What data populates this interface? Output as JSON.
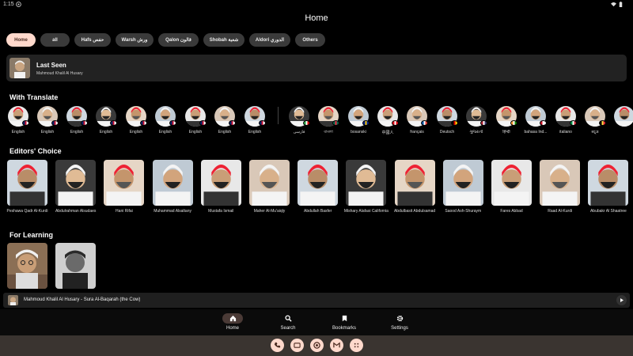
{
  "status": {
    "time": "1:15"
  },
  "appbar": {
    "title": "Home"
  },
  "chips": [
    {
      "label": "Home",
      "active": true
    },
    {
      "label": "all"
    },
    {
      "label": "Hafs حفص"
    },
    {
      "label": "Warsh ورش"
    },
    {
      "label": "Qalon قالون"
    },
    {
      "label": "Shobah شعبة"
    },
    {
      "label": "Aldori الدوري"
    },
    {
      "label": "Others"
    }
  ],
  "last_seen": {
    "title": "Last Seen",
    "reciter": "Mahmoud Khalil Al Husary"
  },
  "with_translate": {
    "title": "With Translate",
    "items": [
      {
        "label": "English",
        "flag": "uk"
      },
      {
        "label": "English",
        "flag": "uk"
      },
      {
        "label": "English",
        "flag": "uk"
      },
      {
        "label": "English",
        "flag": "uk"
      },
      {
        "label": "English",
        "flag": "uk"
      },
      {
        "label": "English",
        "flag": "uk"
      },
      {
        "label": "English",
        "flag": "uk"
      },
      {
        "label": "English",
        "flag": "uk"
      },
      {
        "label": "English",
        "flag": "uk"
      },
      {
        "label": "فارسی",
        "flag": "ir"
      },
      {
        "label": "বাংলা",
        "flag": "bd"
      },
      {
        "label": "bosanski",
        "flag": "ba"
      },
      {
        "label": "中國人",
        "flag": "tr"
      },
      {
        "label": "français",
        "flag": "fr"
      },
      {
        "label": "Deutsch",
        "flag": "de"
      },
      {
        "label": "ગુજરાતી",
        "flag": "us"
      },
      {
        "label": "हिन्दी",
        "flag": "in"
      },
      {
        "label": "bahasa Ind...",
        "flag": "id"
      },
      {
        "label": "italiano",
        "flag": "it"
      },
      {
        "label": "ಕನ್ನಡ",
        "flag": "be"
      },
      {
        "label": "",
        "flag": "none"
      }
    ]
  },
  "editors_choice": {
    "title": "Editors' Choice",
    "items": [
      {
        "label": "Peshawa Qadr Al-Kurdi"
      },
      {
        "label": "Abdulrahman Alsudaes"
      },
      {
        "label": "Hani Rifai"
      },
      {
        "label": "Muhammad Alsaltany"
      },
      {
        "label": "Mustafa Ismail"
      },
      {
        "label": "Maher Al-Mu'aiqly"
      },
      {
        "label": "Abdullah Basfer"
      },
      {
        "label": "Mishary Alafasi California"
      },
      {
        "label": "Abdulbasit Abdulsamad"
      },
      {
        "label": "Saood Ash-Shuraym"
      },
      {
        "label": "Fares Abbad"
      },
      {
        "label": "Raad Al-Kurdi"
      },
      {
        "label": "Abubakr Al Shaatree"
      }
    ]
  },
  "for_learning": {
    "title": "For Learning",
    "items": [
      {
        "label": ""
      },
      {
        "label": ""
      }
    ]
  },
  "player": {
    "title": "Mahmoud Khalil Al Husary - Sura Al-Baqarah (the Cow)"
  },
  "nav": [
    {
      "label": "Home",
      "icon": "home-icon",
      "active": true
    },
    {
      "label": "Search",
      "icon": "search-icon"
    },
    {
      "label": "Bookmarks",
      "icon": "bookmark-icon"
    },
    {
      "label": "Settings",
      "icon": "gear-icon"
    }
  ],
  "dock": [
    "phone-icon",
    "messages-icon",
    "chrome-icon",
    "gmail-icon",
    "apps-icon"
  ],
  "colors": {
    "accent": "#ffd9cc",
    "card": "#222222",
    "background": "#000000"
  }
}
